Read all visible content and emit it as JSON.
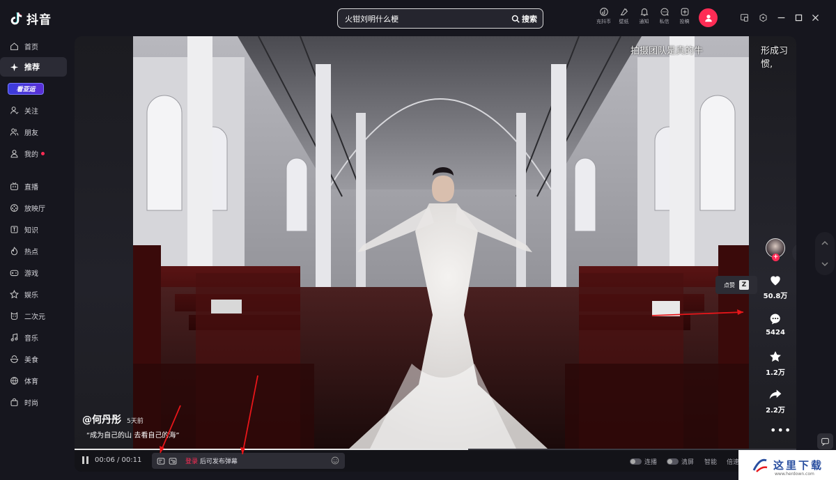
{
  "app": {
    "logo_text": "抖音"
  },
  "search": {
    "value": "火钳刘明什么梗",
    "button_label": "搜索"
  },
  "top_actions": [
    {
      "label": "充抖币",
      "icon": "coin-icon"
    },
    {
      "label": "壁纸",
      "icon": "wallpaper-icon"
    },
    {
      "label": "通知",
      "icon": "bell-icon"
    },
    {
      "label": "私信",
      "icon": "message-icon"
    },
    {
      "label": "投稿",
      "icon": "upload-icon"
    }
  ],
  "sidebar": {
    "items": [
      {
        "label": "首页",
        "icon": "home-icon"
      },
      {
        "label": "推荐",
        "icon": "sparkle-icon",
        "active": true
      },
      {
        "label": "看亚运",
        "icon": "asian-games-badge"
      },
      {
        "label": "关注",
        "icon": "follow-icon"
      },
      {
        "label": "朋友",
        "icon": "friends-icon"
      },
      {
        "label": "我的",
        "icon": "user-icon",
        "has_dot": true
      },
      {
        "label": "直播",
        "icon": "tv-icon"
      },
      {
        "label": "放映厅",
        "icon": "film-icon"
      },
      {
        "label": "知识",
        "icon": "knowledge-icon"
      },
      {
        "label": "热点",
        "icon": "flame-icon"
      },
      {
        "label": "游戏",
        "icon": "gamepad-icon"
      },
      {
        "label": "娱乐",
        "icon": "star-icon"
      },
      {
        "label": "二次元",
        "icon": "anime-icon"
      },
      {
        "label": "音乐",
        "icon": "music-icon"
      },
      {
        "label": "美食",
        "icon": "food-icon"
      },
      {
        "label": "体育",
        "icon": "ball-icon"
      },
      {
        "label": "时尚",
        "icon": "bag-icon"
      }
    ]
  },
  "video": {
    "overlay_left": "拍摄团队是真的牛",
    "overlay_right": "形成习惯,",
    "author": "@何丹彤",
    "posted": "5天前",
    "caption": "“成为自己的山 去看自己的海”",
    "progress": 0.545
  },
  "stats": {
    "likes": "50.8万",
    "comments": "5424",
    "favorites": "1.2万",
    "shares": "2.2万"
  },
  "tooltip": {
    "label": "点赞",
    "key": "Z"
  },
  "controls": {
    "time": "00:06 / 00:11",
    "danmaku_login": "登录",
    "danmaku_hint": "后可发布弹幕",
    "lianbo": "连播",
    "qingping": "清屏",
    "zhineng": "智能",
    "beisu": "倍速"
  },
  "watermark": {
    "text": "这里下载",
    "url": "www.herdown.com"
  },
  "colors": {
    "accent": "#fe2c55",
    "background": "#16161e",
    "panel": "#2d2d35"
  }
}
